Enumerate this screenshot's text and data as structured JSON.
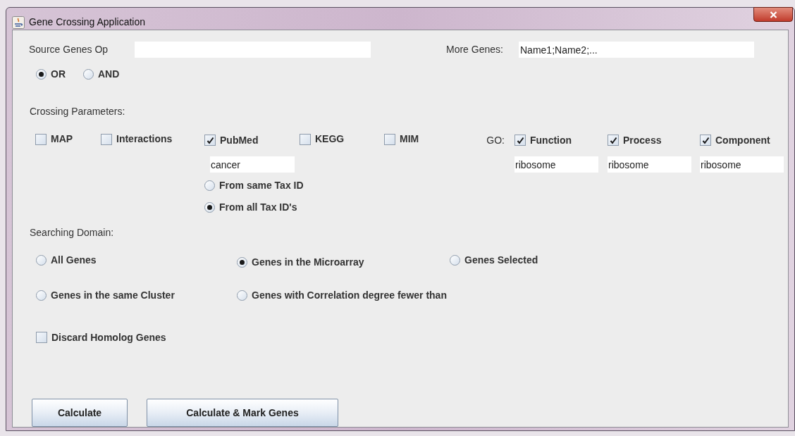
{
  "window": {
    "title": "Gene Crossing Application"
  },
  "source_genes": {
    "label": "Source Genes Op"
  },
  "more_genes": {
    "label": "More Genes:",
    "value": "Name1;Name2;..."
  },
  "operator": [
    {
      "label": "OR",
      "selected": true
    },
    {
      "label": "AND",
      "selected": false
    }
  ],
  "crossing_parameters": {
    "title": "Crossing Parameters:",
    "databases": [
      {
        "label": "MAP",
        "checked": false
      },
      {
        "label": "Interactions",
        "checked": false
      },
      {
        "label": "PubMed",
        "checked": true
      },
      {
        "label": "KEGG",
        "checked": false
      },
      {
        "label": "MIM",
        "checked": false
      }
    ],
    "pubmed_query": "cancer",
    "tax_options": [
      {
        "label": "From same Tax ID",
        "selected": false
      },
      {
        "label": "From all Tax ID's",
        "selected": true
      }
    ],
    "go_label": "GO:",
    "go": [
      {
        "label": "Function",
        "checked": true,
        "value": "ribosome"
      },
      {
        "label": "Process",
        "checked": true,
        "value": "ribosome"
      },
      {
        "label": "Component",
        "checked": true,
        "value": "ribosome"
      }
    ]
  },
  "searching_domain": {
    "title": "Searching Domain:",
    "options": [
      {
        "label": "All Genes",
        "selected": false
      },
      {
        "label": "Genes in the Microarray",
        "selected": true
      },
      {
        "label": "Genes Selected",
        "selected": false
      },
      {
        "label": "Genes in the same Cluster",
        "selected": false
      },
      {
        "label": "Genes with Correlation degree fewer than",
        "selected": false
      }
    ]
  },
  "discard_homolog": {
    "label": "Discard Homolog Genes",
    "checked": false
  },
  "buttons": [
    "Calculate",
    "Calculate & Mark Genes"
  ]
}
